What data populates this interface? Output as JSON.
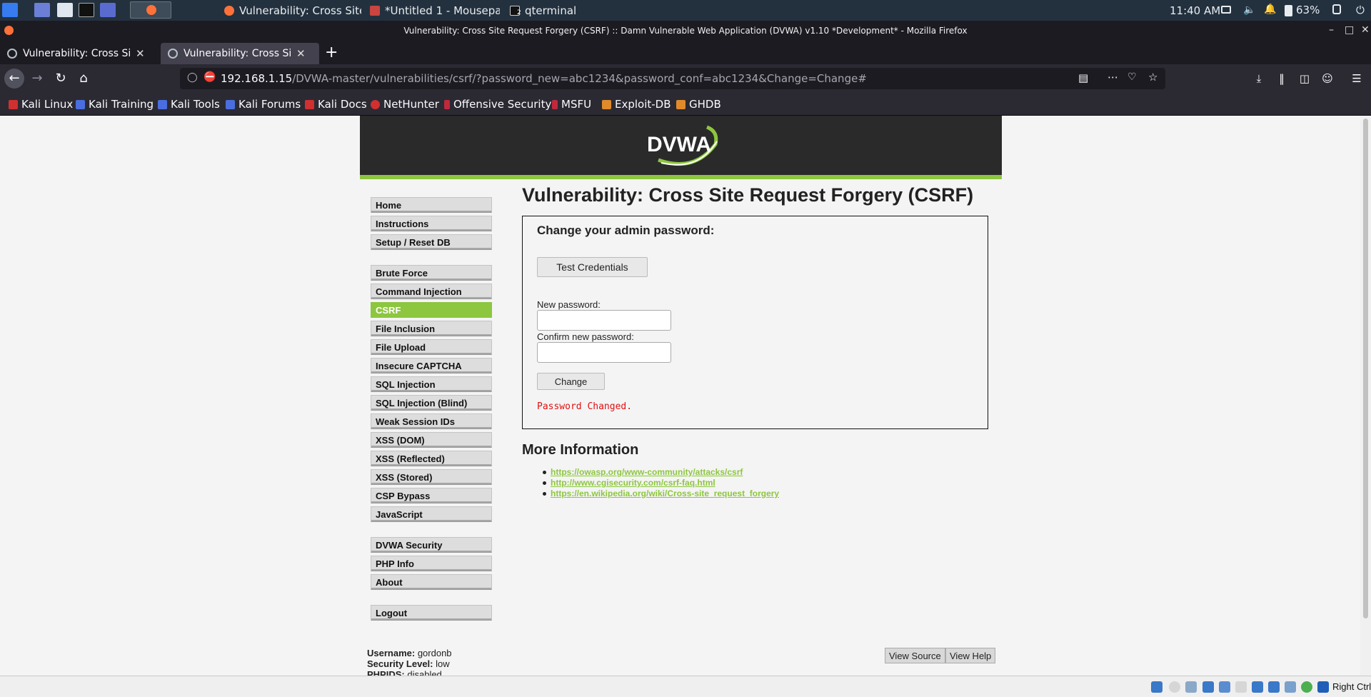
{
  "taskbar": {
    "tasks": [
      "Vulnerability: Cross Site ...",
      "*Untitled 1 - Mousepad",
      "qterminal"
    ],
    "terminal_badge": "2",
    "time": "11:40 AM",
    "battery": "63%"
  },
  "window": {
    "title": "Vulnerability: Cross Site Request Forgery (CSRF) :: Damn Vulnerable Web Application (DVWA) v1.10 *Development* - Mozilla Firefox"
  },
  "browser": {
    "tabs": [
      {
        "label": "Vulnerability: Cross Site R",
        "active": false
      },
      {
        "label": "Vulnerability: Cross Site R",
        "active": true
      }
    ],
    "new_tab": "+",
    "url_host": "192.168.1.15",
    "url_path": "/DVWA-master/vulnerabilities/csrf/?password_new=abc1234&password_conf=abc1234&Change=Change#",
    "bookmarks": [
      "Kali Linux",
      "Kali Training",
      "Kali Tools",
      "Kali Forums",
      "Kali Docs",
      "NetHunter",
      "Offensive Security",
      "MSFU",
      "Exploit-DB",
      "GHDB"
    ]
  },
  "dvwa": {
    "logo": "DVWA",
    "menu_group1": [
      "Home",
      "Instructions",
      "Setup / Reset DB"
    ],
    "menu_group2": [
      "Brute Force",
      "Command Injection",
      "CSRF",
      "File Inclusion",
      "File Upload",
      "Insecure CAPTCHA",
      "SQL Injection",
      "SQL Injection (Blind)",
      "Weak Session IDs",
      "XSS (DOM)",
      "XSS (Reflected)",
      "XSS (Stored)",
      "CSP Bypass",
      "JavaScript"
    ],
    "menu_group3": [
      "DVWA Security",
      "PHP Info",
      "About"
    ],
    "menu_group4": [
      "Logout"
    ],
    "selected_item": "CSRF",
    "page_title": "Vulnerability: Cross Site Request Forgery (CSRF)",
    "form": {
      "heading": "Change your admin password:",
      "test_button": "Test Credentials",
      "new_password_label": "New password:",
      "new_password_value": "",
      "confirm_label": "Confirm new password:",
      "confirm_value": "",
      "change_button": "Change",
      "message": "Password Changed."
    },
    "more_info_title": "More Information",
    "links": [
      "https://owasp.org/www-community/attacks/csrf",
      "http://www.cgisecurity.com/csrf-faq.html",
      "https://en.wikipedia.org/wiki/Cross-site_request_forgery"
    ],
    "user": {
      "username_label": "Username:",
      "username": "gordonb",
      "security_label": "Security Level:",
      "security": "low",
      "phpids_label": "PHPIDS:",
      "phpids": "disabled"
    },
    "view_source": "View Source",
    "view_help": "View Help"
  },
  "vm": {
    "host_key": "Right Ctrl"
  },
  "colors": {
    "dvwa_green": "#8dc63f",
    "header_bg": "#2a2a2a",
    "error_red": "#e01010",
    "panel_bg": "#23313f"
  }
}
